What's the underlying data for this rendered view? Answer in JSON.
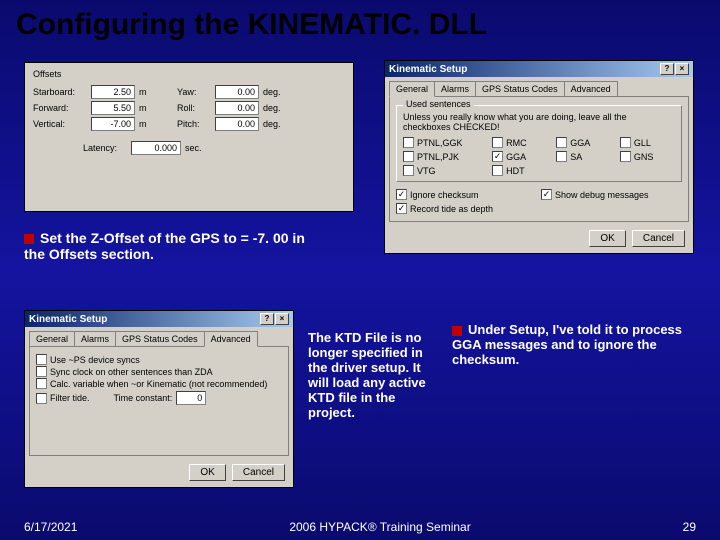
{
  "title": "Configuring the KINEMATIC. DLL",
  "caption1": "Set  the Z-Offset of the GPS to = -7. 00 in the Offsets section.",
  "caption2": "The KTD File is no longer specified in the driver setup.  It will load any active KTD file in the project.",
  "caption3": "Under Setup, I've told it to process GGA messages and to ignore the checksum.",
  "footer": {
    "date": "6/17/2021",
    "center": "2006 HYPACK® Training Seminar",
    "page": "29"
  },
  "offsets": {
    "title": "Offsets",
    "rows": {
      "starboard": {
        "label": "Starboard:",
        "value": "2.50",
        "unit": "m",
        "r_label": "Yaw:",
        "r_value": "0.00",
        "r_unit": "deg."
      },
      "forward": {
        "label": "Forward:",
        "value": "5.50",
        "unit": "m",
        "r_label": "Roll:",
        "r_value": "0.00",
        "r_unit": "deg."
      },
      "vertical": {
        "label": "Vertical:",
        "value": "-7.00",
        "unit": "m",
        "r_label": "Pitch:",
        "r_value": "0.00",
        "r_unit": "deg."
      },
      "latency": {
        "label": "Latency:",
        "value": "0.000",
        "unit": "sec."
      }
    }
  },
  "setup1": {
    "title": "Kinematic Setup",
    "tabs": [
      "General",
      "Alarms",
      "GPS Status Codes",
      "Advanced"
    ],
    "group_title": "Used sentences",
    "hint": "Unless you really know what you are doing, leave all the checkboxes CHECKED!",
    "items": [
      {
        "label": "PTNL,GGK",
        "checked": false
      },
      {
        "label": "RMC",
        "checked": false
      },
      {
        "label": "GGA",
        "checked": false
      },
      {
        "label": "GLL",
        "checked": false
      },
      {
        "label": "PTNL,PJK",
        "checked": false
      },
      {
        "label": "GGA",
        "checked": true
      },
      {
        "label": "SA",
        "checked": false
      },
      {
        "label": "GNS",
        "checked": false
      },
      {
        "label": "VTG",
        "checked": false
      },
      {
        "label": "HDT",
        "checked": false
      }
    ],
    "ignore": {
      "label": "Ignore checksum",
      "checked": true
    },
    "debug": {
      "label": "Show debug messages",
      "checked": true
    },
    "record": {
      "label": "Record tide as depth",
      "checked": true
    },
    "ok": "OK",
    "cancel": "Cancel"
  },
  "setup2": {
    "title": "Kinematic Setup",
    "tabs": [
      "General",
      "Alarms",
      "GPS Status Codes",
      "Advanced"
    ],
    "items": [
      {
        "label": "Use ~PS device syncs",
        "checked": false
      },
      {
        "label": "Sync clock on other sentences than ZDA",
        "checked": false
      },
      {
        "label": "Calc. variable when ~or Kinematic (not recommended)",
        "checked": false
      },
      {
        "label": "Filter tide.",
        "checked": false
      }
    ],
    "filter_label": "Time constant:",
    "filter_value": "0",
    "ok": "OK",
    "cancel": "Cancel"
  }
}
